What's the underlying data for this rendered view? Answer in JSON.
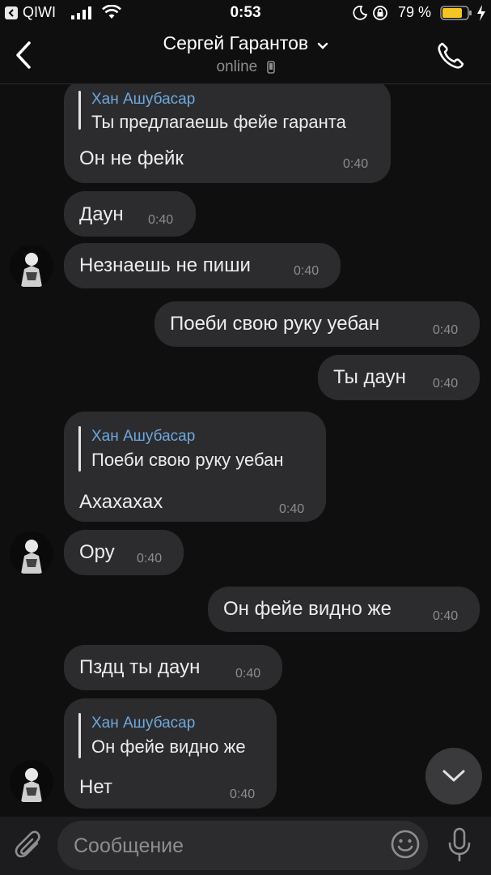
{
  "status_bar": {
    "carrier": "QIWI",
    "time": "0:53",
    "battery_percent": "79 %"
  },
  "header": {
    "contact_name": "Сергей Гарантов",
    "presence": "online"
  },
  "messages": [
    {
      "side": "in",
      "reply_to": {
        "name": "Хан Ашубасар",
        "text": "Ты предлагаешь фейе гаранта"
      },
      "text": "Он не фейк",
      "time": "0:40"
    },
    {
      "side": "in",
      "text": "Даун",
      "time": "0:40"
    },
    {
      "side": "in",
      "text": "Незнаешь не пиши",
      "time": "0:40",
      "avatar": true
    },
    {
      "side": "out",
      "text": "Поеби свою руку уебан",
      "time": "0:40"
    },
    {
      "side": "out",
      "text": "Ты даун",
      "time": "0:40"
    },
    {
      "side": "in",
      "reply_to": {
        "name": "Хан Ашубасар",
        "text": "Поеби свою руку уебан"
      },
      "text": "Ахахахах",
      "time": "0:40"
    },
    {
      "side": "in",
      "text": "Ору",
      "time": "0:40",
      "avatar": true
    },
    {
      "side": "out",
      "text": "Он фейе видно же",
      "time": "0:40"
    },
    {
      "side": "in",
      "text": "Пздц ты даун",
      "time": "0:40"
    },
    {
      "side": "in",
      "reply_to": {
        "name": "Хан Ашубасар",
        "text": "Он фейе видно же"
      },
      "text": "Нет",
      "time": "0:40",
      "avatar": true
    }
  ],
  "composer": {
    "placeholder": "Сообщение"
  },
  "colors": {
    "background": "#0f0f0f",
    "bubble": "#2c2c2e",
    "reply_name": "#6ea7de",
    "timestamp": "#8c8c8c"
  },
  "icons": [
    "back-chevron-icon",
    "dropdown-chevron-icon",
    "phone-icon",
    "call-icon",
    "scroll-down-chevron-icon",
    "attach-paperclip-icon",
    "emoji-icon",
    "microphone-icon"
  ]
}
